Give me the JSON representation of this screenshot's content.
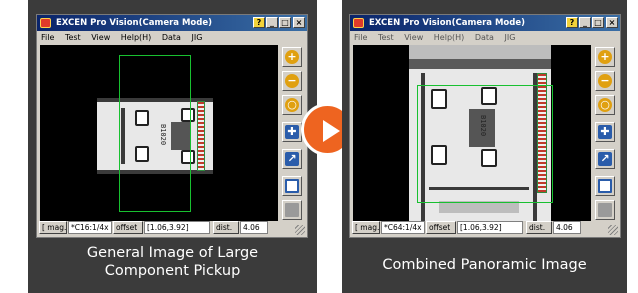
{
  "left": {
    "window_title": "EXCEN Pro Vision(Camera Mode)",
    "menu": [
      "File",
      "Test",
      "View",
      "Help(H)",
      "Data",
      "JIG"
    ],
    "chip_text": "B1020",
    "status": {
      "mag_label": "[ mag.",
      "mag_value": "*C16:1/4x",
      "offset_label": "offset",
      "offset_value": "[1.06,3.92]",
      "dist_label": "dist.",
      "dist_value": "4.06"
    },
    "caption_line1": "General Image of Large",
    "caption_line2": "Component Pickup"
  },
  "right": {
    "window_title": "EXCEN Pro Vision(Camera Mode)",
    "menu": [
      "File",
      "Test",
      "View",
      "Help(H)",
      "Data",
      "JIG"
    ],
    "chip_text": "B1020",
    "status": {
      "mag_label": "[ mag.",
      "mag_value": "*C64:1/4x",
      "offset_label": "offset",
      "offset_value": "[1.06,3.92]",
      "dist_label": "dist.",
      "dist_value": "4.06"
    },
    "caption": "Combined Panoramic Image"
  },
  "titlebar_buttons": [
    "?",
    "_",
    "□",
    "×"
  ],
  "toolbar_icons": [
    "zoom-in-icon",
    "zoom-out-icon",
    "zoom-fit-icon",
    "fit-screen-icon",
    "select-rect-icon",
    "frame-icon",
    "stop-icon"
  ],
  "colors": {
    "panel_bg": "#3b3b3b",
    "accent_arrow": "#ee6420",
    "title_blue": "#0a246a",
    "green_box": "#18c030"
  }
}
